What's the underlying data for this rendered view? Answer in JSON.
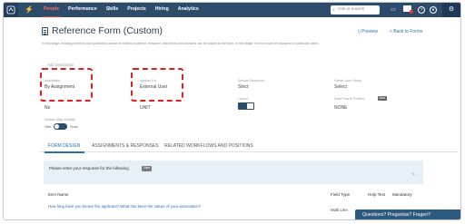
{
  "topnav": {
    "items": [
      {
        "label": "People",
        "active": true
      },
      {
        "label": "Performance",
        "active": false
      },
      {
        "label": "Skills",
        "active": false
      },
      {
        "label": "Projects",
        "active": false
      },
      {
        "label": "Hiring",
        "active": false
      },
      {
        "label": "Analytics",
        "active": false
      }
    ],
    "search_placeholder": "Ask or search"
  },
  "header": {
    "title": "Reference Form (Custom)",
    "preview": "Preview",
    "back": "< Back to Forms",
    "description": "In this stage, existing sections and questions cannot be edited or altered. However, new items and sections can be added to the form. In this stage, the form can be assigned to particular users."
  },
  "form": {
    "add_description": "Add Description",
    "availability": {
      "label": "Availability",
      "value": "By Assignment"
    },
    "applies_for": {
      "label": "Applies For",
      "value": "External User"
    },
    "section_sequence": {
      "label": "Section Sequence",
      "value": "Strict"
    },
    "owner_user_group": {
      "label": "Owner User Group",
      "value": "Select"
    },
    "row2_col1_value": "No",
    "row2_col2_value": "UNIT",
    "layout_label": "Layout",
    "data_flow_label": "Data Flow to Profiles",
    "beta": "Beta",
    "data_flow_value": "NONE",
    "section_visibility_label": "Section Map Visibility",
    "hide": "Hide",
    "show": "Show"
  },
  "tabs": [
    "FORM DESIGN",
    "ASSIGNMENTS & RESPONSES",
    "RELATED WORKFLOWS AND POSITIONS"
  ],
  "instructions": {
    "text": "Please enter your response for the following",
    "chip": "User"
  },
  "table": {
    "headers": [
      "Item Name",
      "Field Type",
      "Help Text",
      "Mandatory"
    ],
    "rows": [
      {
        "item": "How long have you known the applicant? What has been the nature of your association?",
        "type": "Multi Line"
      }
    ]
  },
  "chat": {
    "label": "Questions? Preguntas? Fragen?"
  },
  "colors": {
    "nav": "#2c4c6b",
    "accent": "#2d6fb5",
    "highlight": "#e02020",
    "instruction_bg": "#e6f1f7"
  }
}
